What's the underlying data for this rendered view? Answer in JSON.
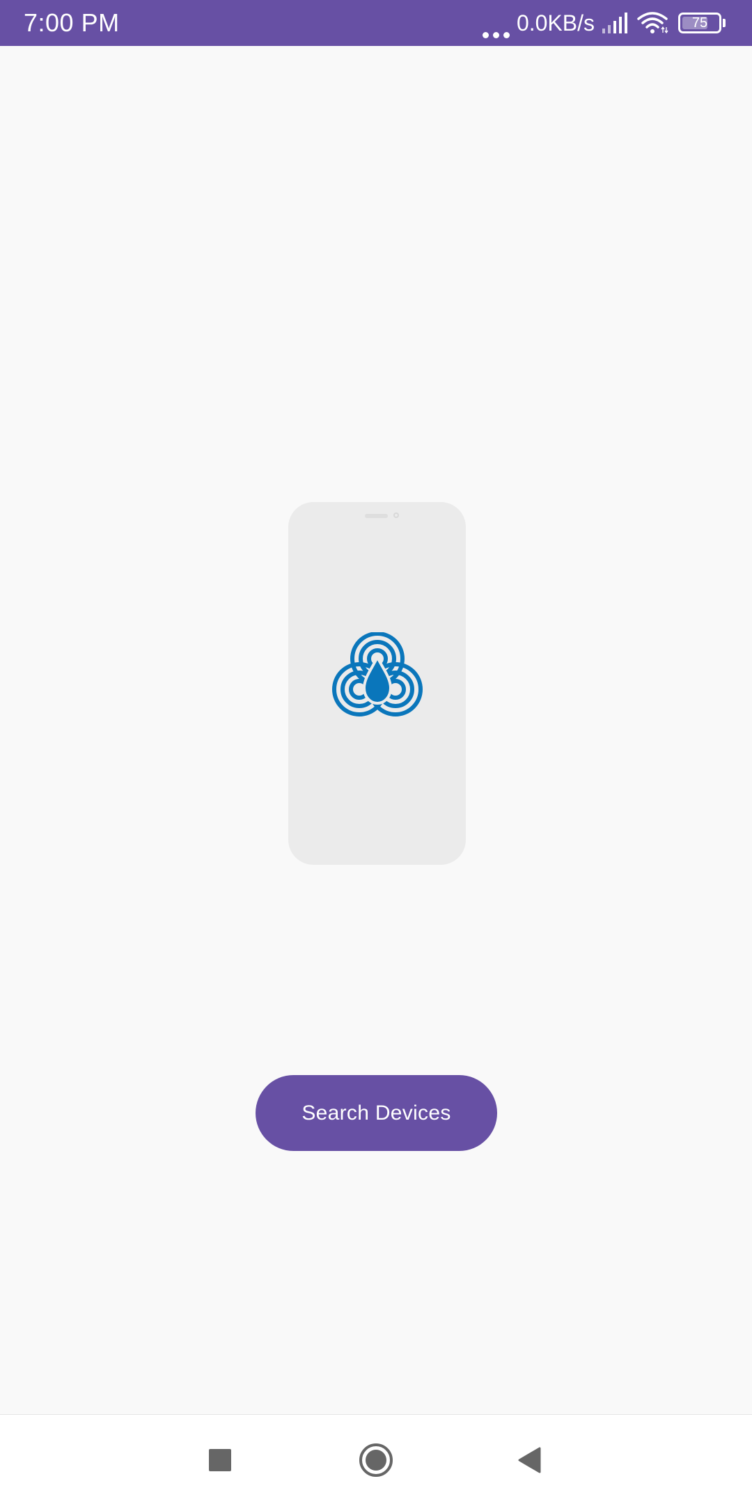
{
  "status_bar": {
    "time": "7:00 PM",
    "network_speed": "0.0KB/s",
    "battery_level": "75",
    "battery_fraction": 0.75,
    "icons": [
      "more-dots-icon",
      "cell-signal-icon",
      "wifi-icon",
      "battery-icon"
    ]
  },
  "main": {
    "illustration": {
      "logo_icon": "water-drop-rings-logo-icon",
      "logo_color": "#0a76bb"
    },
    "search_button_label": "Search Devices"
  },
  "nav_bar": {
    "icons": [
      "recents-square-icon",
      "home-circle-icon",
      "back-triangle-icon"
    ]
  },
  "colors": {
    "primary": "#6750a4",
    "background": "#f9f9f9",
    "logo_blue": "#0a76bb"
  }
}
